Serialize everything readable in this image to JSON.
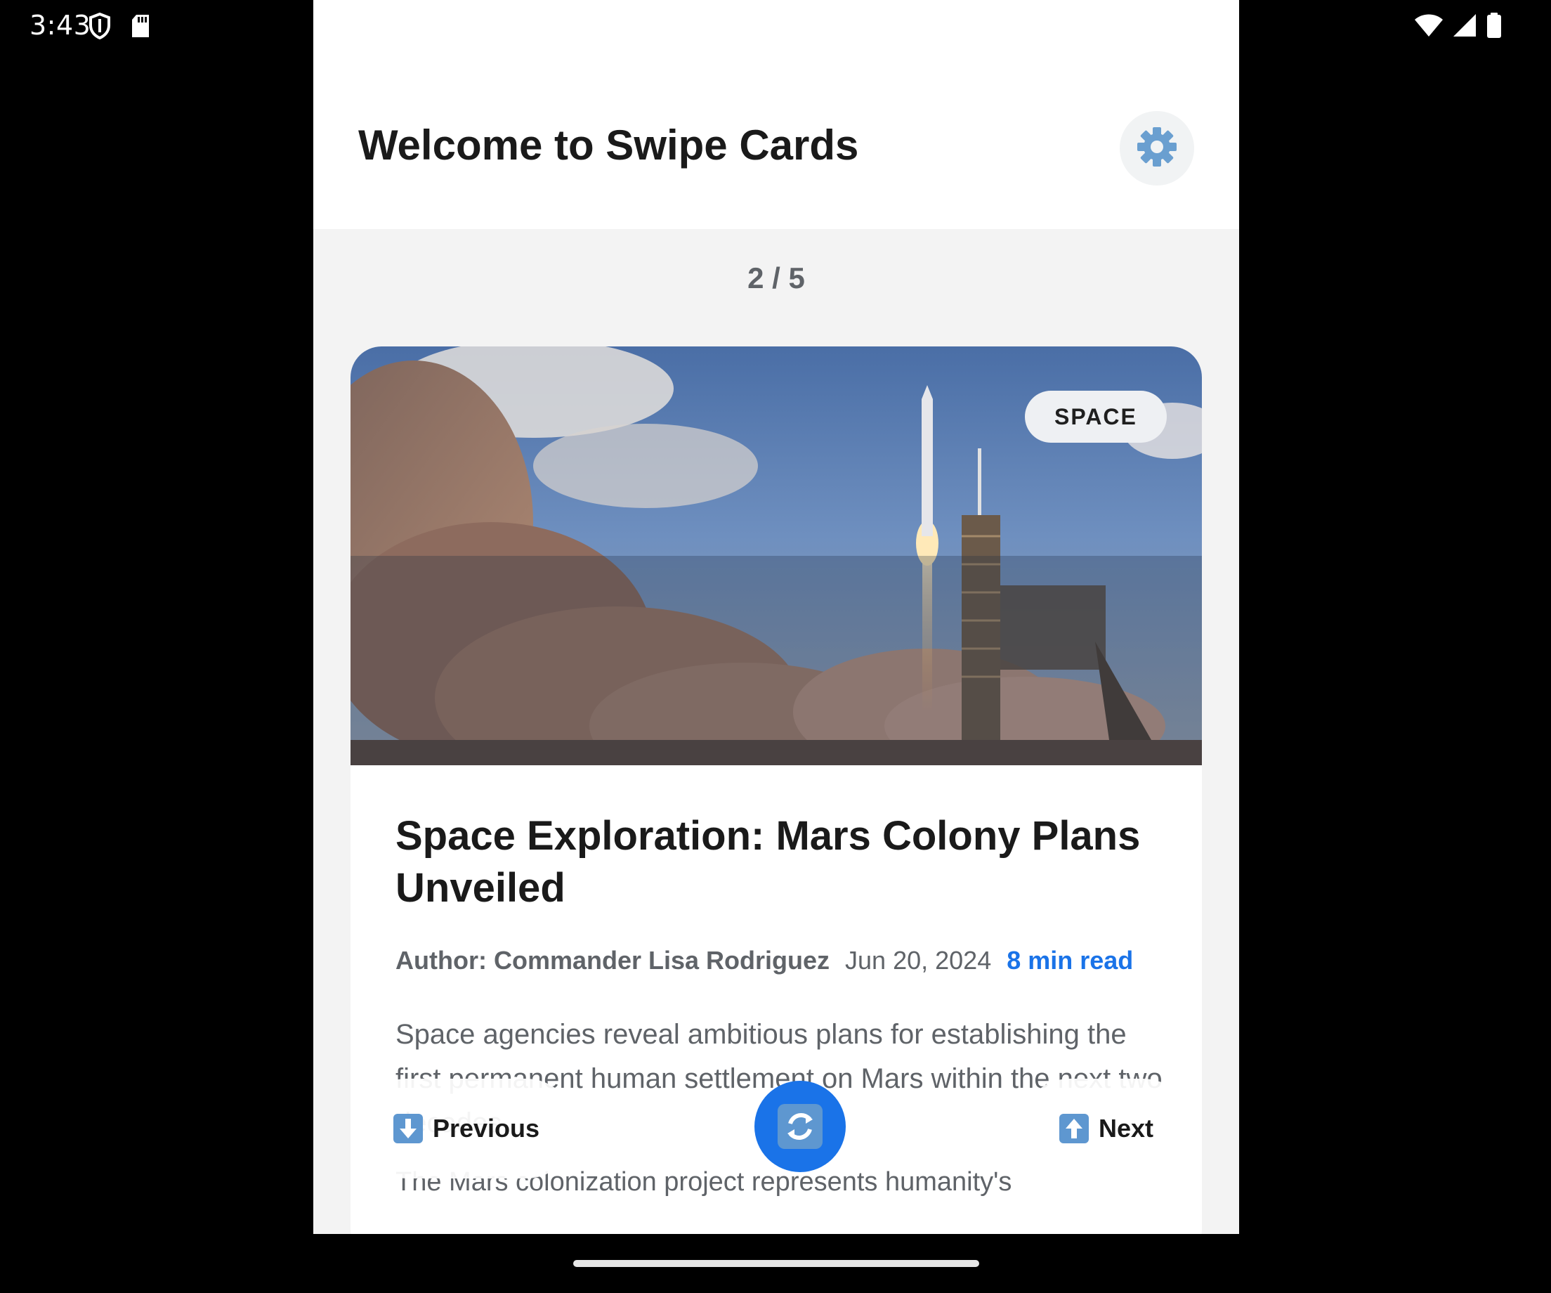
{
  "status_bar": {
    "time": "3:43",
    "left_icons": [
      "shield-icon",
      "sd-card-icon"
    ],
    "right_icons": [
      "wifi-icon",
      "signal-icon",
      "battery-icon"
    ]
  },
  "header": {
    "title": "Welcome to Swipe Cards",
    "settings_icon": "gear-icon"
  },
  "counter": "2 / 5",
  "card": {
    "category": "SPACE",
    "image_icon": "rocket-launch-image",
    "title": "Space Exploration: Mars Colony Plans Unveiled",
    "author": "Author: Commander Lisa Rodriguez",
    "date": "Jun 20, 2024",
    "read_time": "8 min read",
    "summary": "Space agencies reveal ambitious plans for establishing the first permanent human settlement on Mars within the next two decades.",
    "body": "The Mars colonization project represents humanity's"
  },
  "controls": {
    "previous_label": "Previous",
    "next_label": "Next",
    "previous_icon": "down-arrow-icon",
    "next_icon": "up-arrow-icon",
    "shuffle_icon": "shuffle-icon"
  },
  "colors": {
    "accent": "#1a73e8",
    "header_bg": "#ffffff",
    "content_bg": "#f3f3f3",
    "title_text": "#1a1a1a",
    "muted_text": "#5f6368"
  }
}
